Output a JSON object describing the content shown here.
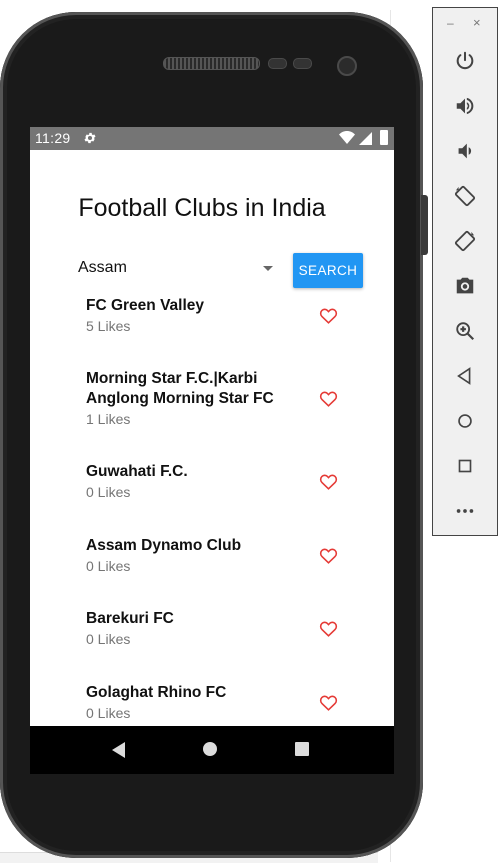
{
  "status_bar": {
    "time": "11:29"
  },
  "app": {
    "title": "Football Clubs in India",
    "state_select": {
      "value": "Assam"
    },
    "search_button": "SEARCH",
    "clubs": [
      {
        "name": "FC Green Valley",
        "likes": "5 Likes"
      },
      {
        "name": "Morning Star F.C.|Karbi Anglong Morning Star FC",
        "likes": "1 Likes"
      },
      {
        "name": "Guwahati F.C.",
        "likes": "0 Likes"
      },
      {
        "name": "Assam Dynamo Club",
        "likes": "0 Likes"
      },
      {
        "name": "Barekuri FC",
        "likes": "0 Likes"
      },
      {
        "name": "Golaghat Rhino FC",
        "likes": "0 Likes"
      }
    ]
  },
  "emulator_toolbar": {
    "minimize": "–",
    "close": "×",
    "buttons": [
      "power-icon",
      "volume-up-icon",
      "volume-down-icon",
      "rotate-left-icon",
      "rotate-right-icon",
      "camera-icon",
      "zoom-icon",
      "back-icon",
      "home-icon",
      "overview-icon",
      "more-icon"
    ]
  },
  "colors": {
    "accent": "#2196f3",
    "heart": "#e53935",
    "status_bar": "#757575"
  }
}
